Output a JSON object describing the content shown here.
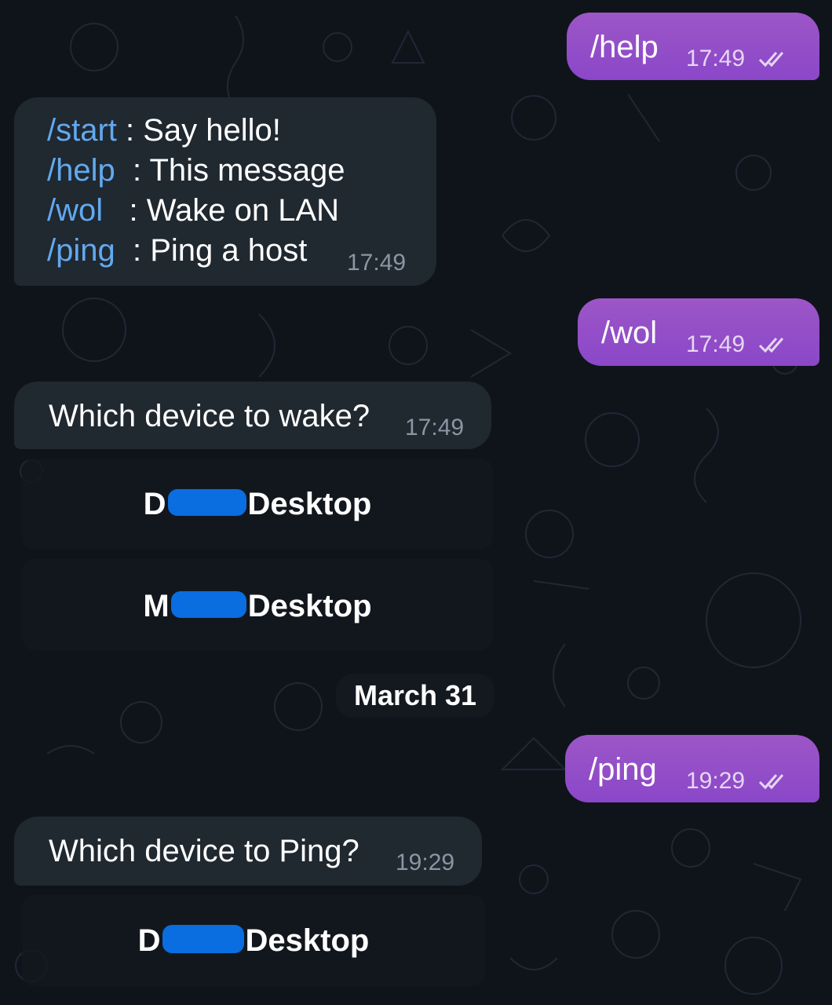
{
  "chat": {
    "messages": [
      {
        "direction": "outgoing",
        "text": "/help",
        "time": "17:49",
        "status": "read-double-check"
      },
      {
        "direction": "incoming",
        "lines": [
          {
            "command": "/start",
            "sep": " : ",
            "desc": "Say hello!"
          },
          {
            "command": "/help",
            "sep": "  : ",
            "desc": "This message"
          },
          {
            "command": "/wol",
            "sep": "   : ",
            "desc": "Wake on LAN"
          },
          {
            "command": "/ping",
            "sep": "  : ",
            "desc": "Ping a host"
          }
        ],
        "time": "17:49"
      },
      {
        "direction": "outgoing",
        "text": "/wol",
        "time": "17:49",
        "status": "read-double-check"
      },
      {
        "direction": "incoming",
        "text": "Which device to wake?",
        "time": "17:49",
        "buttons": [
          {
            "prefix": "D",
            "suffix": "Desktop",
            "redacted": true
          },
          {
            "prefix": "M",
            "suffix": "Desktop",
            "redacted": true
          }
        ]
      },
      {
        "direction": "date-separator",
        "text": "March 31"
      },
      {
        "direction": "outgoing",
        "text": "/ping",
        "time": "19:29",
        "status": "read-double-check"
      },
      {
        "direction": "incoming",
        "text": "Which device to Ping?",
        "time": "19:29",
        "buttons": [
          {
            "prefix": "D",
            "suffix": "Desktop",
            "redacted": true
          }
        ]
      }
    ]
  },
  "colors": {
    "background": "#0f141b",
    "outgoing_bubble": "#8a47c8",
    "incoming_bubble": "#202830",
    "command_link": "#62a9ef",
    "redaction": "#0a6de0"
  },
  "icons": {
    "read_status": "double-check-icon",
    "wallpaper": "doodle-pattern"
  }
}
